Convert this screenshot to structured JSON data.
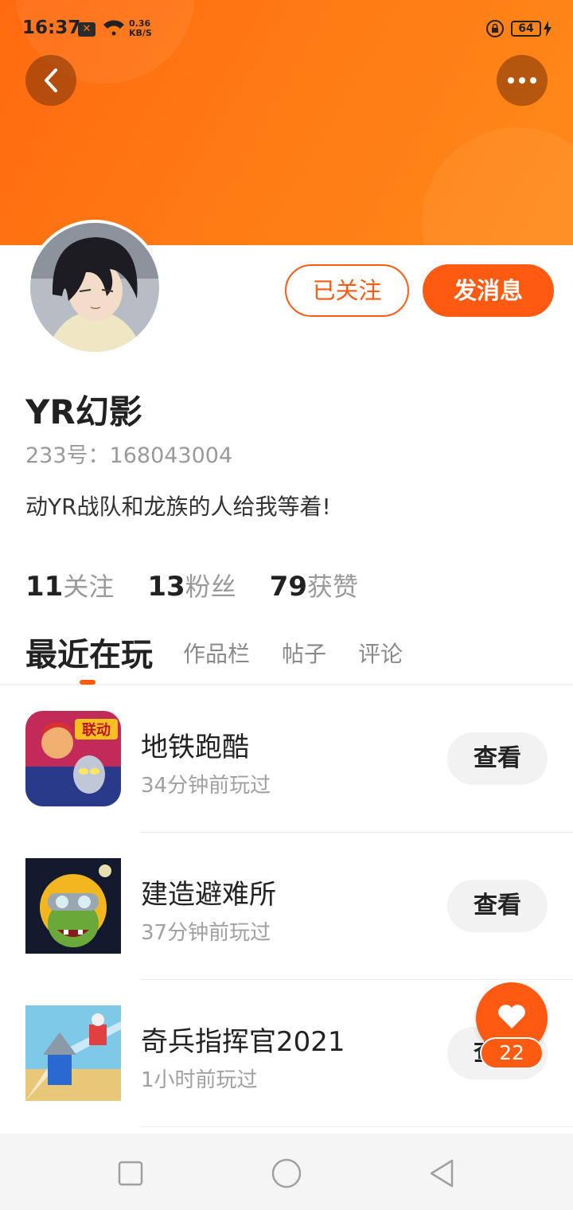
{
  "status_bar": {
    "time": "16:37",
    "network_speed": "0.36",
    "network_unit": "KB/S",
    "battery": "64",
    "icons": [
      "x-notification-icon",
      "wifi-icon",
      "lock-rotation-icon",
      "battery-icon",
      "charging-bolt-icon"
    ]
  },
  "header": {
    "accent_color": "#ff7a14",
    "back_icon": "chevron-left-icon",
    "more_icon": "more-dots-icon"
  },
  "profile": {
    "username": "YR幻影",
    "id_text": "233号：168043004",
    "bio": "动YR战队和龙族的人给我等着!",
    "following_button": "已关注",
    "message_button": "发消息"
  },
  "stats": [
    {
      "number": "11",
      "label": "关注"
    },
    {
      "number": "13",
      "label": "粉丝"
    },
    {
      "number": "79",
      "label": "获赞"
    }
  ],
  "tabs": {
    "active": "最近在玩",
    "items": [
      "作品栏",
      "帖子",
      "评论"
    ]
  },
  "games": [
    {
      "name": "地铁跑酷",
      "time": "34分钟前玩过",
      "button": "查看",
      "icon_badge": "联动"
    },
    {
      "name": "建造避难所",
      "time": "37分钟前玩过",
      "button": "查看"
    },
    {
      "name": "奇兵指挥官2021",
      "time": "1小时前玩过",
      "button": "查看"
    }
  ],
  "like_button": {
    "count": "22",
    "icon": "heart-icon",
    "color": "#ff5a12"
  },
  "nav_bar": {
    "icons": [
      "recent-apps-icon",
      "home-icon",
      "back-icon"
    ]
  }
}
